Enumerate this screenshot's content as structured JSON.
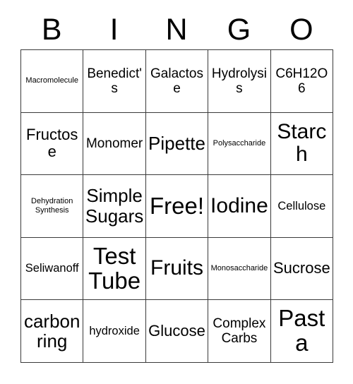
{
  "card": {
    "headers": [
      "B",
      "I",
      "N",
      "G",
      "O"
    ],
    "rows": [
      [
        {
          "text": "Macromolecule",
          "size": "fs-xs"
        },
        {
          "text": "Benedict's",
          "size": "fs-md"
        },
        {
          "text": "Galactose",
          "size": "fs-md"
        },
        {
          "text": "Hydrolysis",
          "size": "fs-md"
        },
        {
          "text": "C6H12O6",
          "size": "fs-md"
        }
      ],
      [
        {
          "text": "Fructose",
          "size": "fs-lg"
        },
        {
          "text": "Monomer",
          "size": "fs-md"
        },
        {
          "text": "Pipette",
          "size": "fs-xl"
        },
        {
          "text": "Polysaccharide",
          "size": "fs-xs"
        },
        {
          "text": "Starch",
          "size": "fs-xxl"
        }
      ],
      [
        {
          "text": "Dehydration Synthesis",
          "size": "fs-xs"
        },
        {
          "text": "Simple Sugars",
          "size": "fs-xl"
        },
        {
          "text": "Free!",
          "size": "fs-hg"
        },
        {
          "text": "Iodine",
          "size": "fs-xxl"
        },
        {
          "text": "Cellulose",
          "size": "fs-sm"
        }
      ],
      [
        {
          "text": "Seliwanoff",
          "size": "fs-sm"
        },
        {
          "text": "Test Tube",
          "size": "fs-hg"
        },
        {
          "text": "Fruits",
          "size": "fs-xxl"
        },
        {
          "text": "Monosaccharide",
          "size": "fs-xs"
        },
        {
          "text": "Sucrose",
          "size": "fs-lg"
        }
      ],
      [
        {
          "text": "carbon ring",
          "size": "fs-xl"
        },
        {
          "text": "hydroxide",
          "size": "fs-sm"
        },
        {
          "text": "Glucose",
          "size": "fs-lg"
        },
        {
          "text": "Complex Carbs",
          "size": "fs-md"
        },
        {
          "text": "Pasta",
          "size": "fs-hg"
        }
      ]
    ]
  }
}
